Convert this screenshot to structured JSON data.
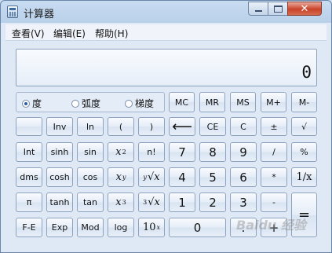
{
  "window": {
    "title": "计算器",
    "close_glyph": "✕"
  },
  "menu": {
    "items": [
      "查看(V)",
      "编辑(E)",
      "帮助(H)"
    ]
  },
  "display": {
    "value": "0"
  },
  "angle_mode": {
    "options": [
      "度",
      "弧度",
      "梯度"
    ],
    "selected": "度"
  },
  "keys": {
    "memory": [
      "MC",
      "MR",
      "MS",
      "M+",
      "M-"
    ],
    "inv": "Inv",
    "ln": "ln",
    "lparen": "(",
    "rparen": ")",
    "backspace": "⟵",
    "ce": "CE",
    "c": "C",
    "plusminus": "±",
    "sqrt": "√",
    "int": "Int",
    "sinh": "sinh",
    "sin": "sin",
    "x_sq_base": "x",
    "x_sq_exp": "2",
    "fact": "n!",
    "seven": "7",
    "eight": "8",
    "nine": "9",
    "divide": "/",
    "percent": "%",
    "dms": "dms",
    "cosh": "cosh",
    "cos": "cos",
    "xy_base": "x",
    "xy_exp": "y",
    "yroot_pre": "y",
    "yroot_sym": "√",
    "yroot_x": "x",
    "four": "4",
    "five": "5",
    "six": "6",
    "multiply": "*",
    "reciprocal": "1/x",
    "pi": "π",
    "tanh": "tanh",
    "tan": "tan",
    "x_cube_base": "x",
    "x_cube_exp": "3",
    "cuberoot_pre": "3",
    "cuberoot_sym": "√",
    "cuberoot_x": "x",
    "one": "1",
    "two": "2",
    "three": "3",
    "minus": "-",
    "equals": "=",
    "fe": "F-E",
    "exp": "Exp",
    "mod": "Mod",
    "log": "log",
    "tenx_base": "10",
    "tenx_exp": "x",
    "zero": "0",
    "dot": ".",
    "plus": "+"
  },
  "watermark": "Baidu 经验"
}
